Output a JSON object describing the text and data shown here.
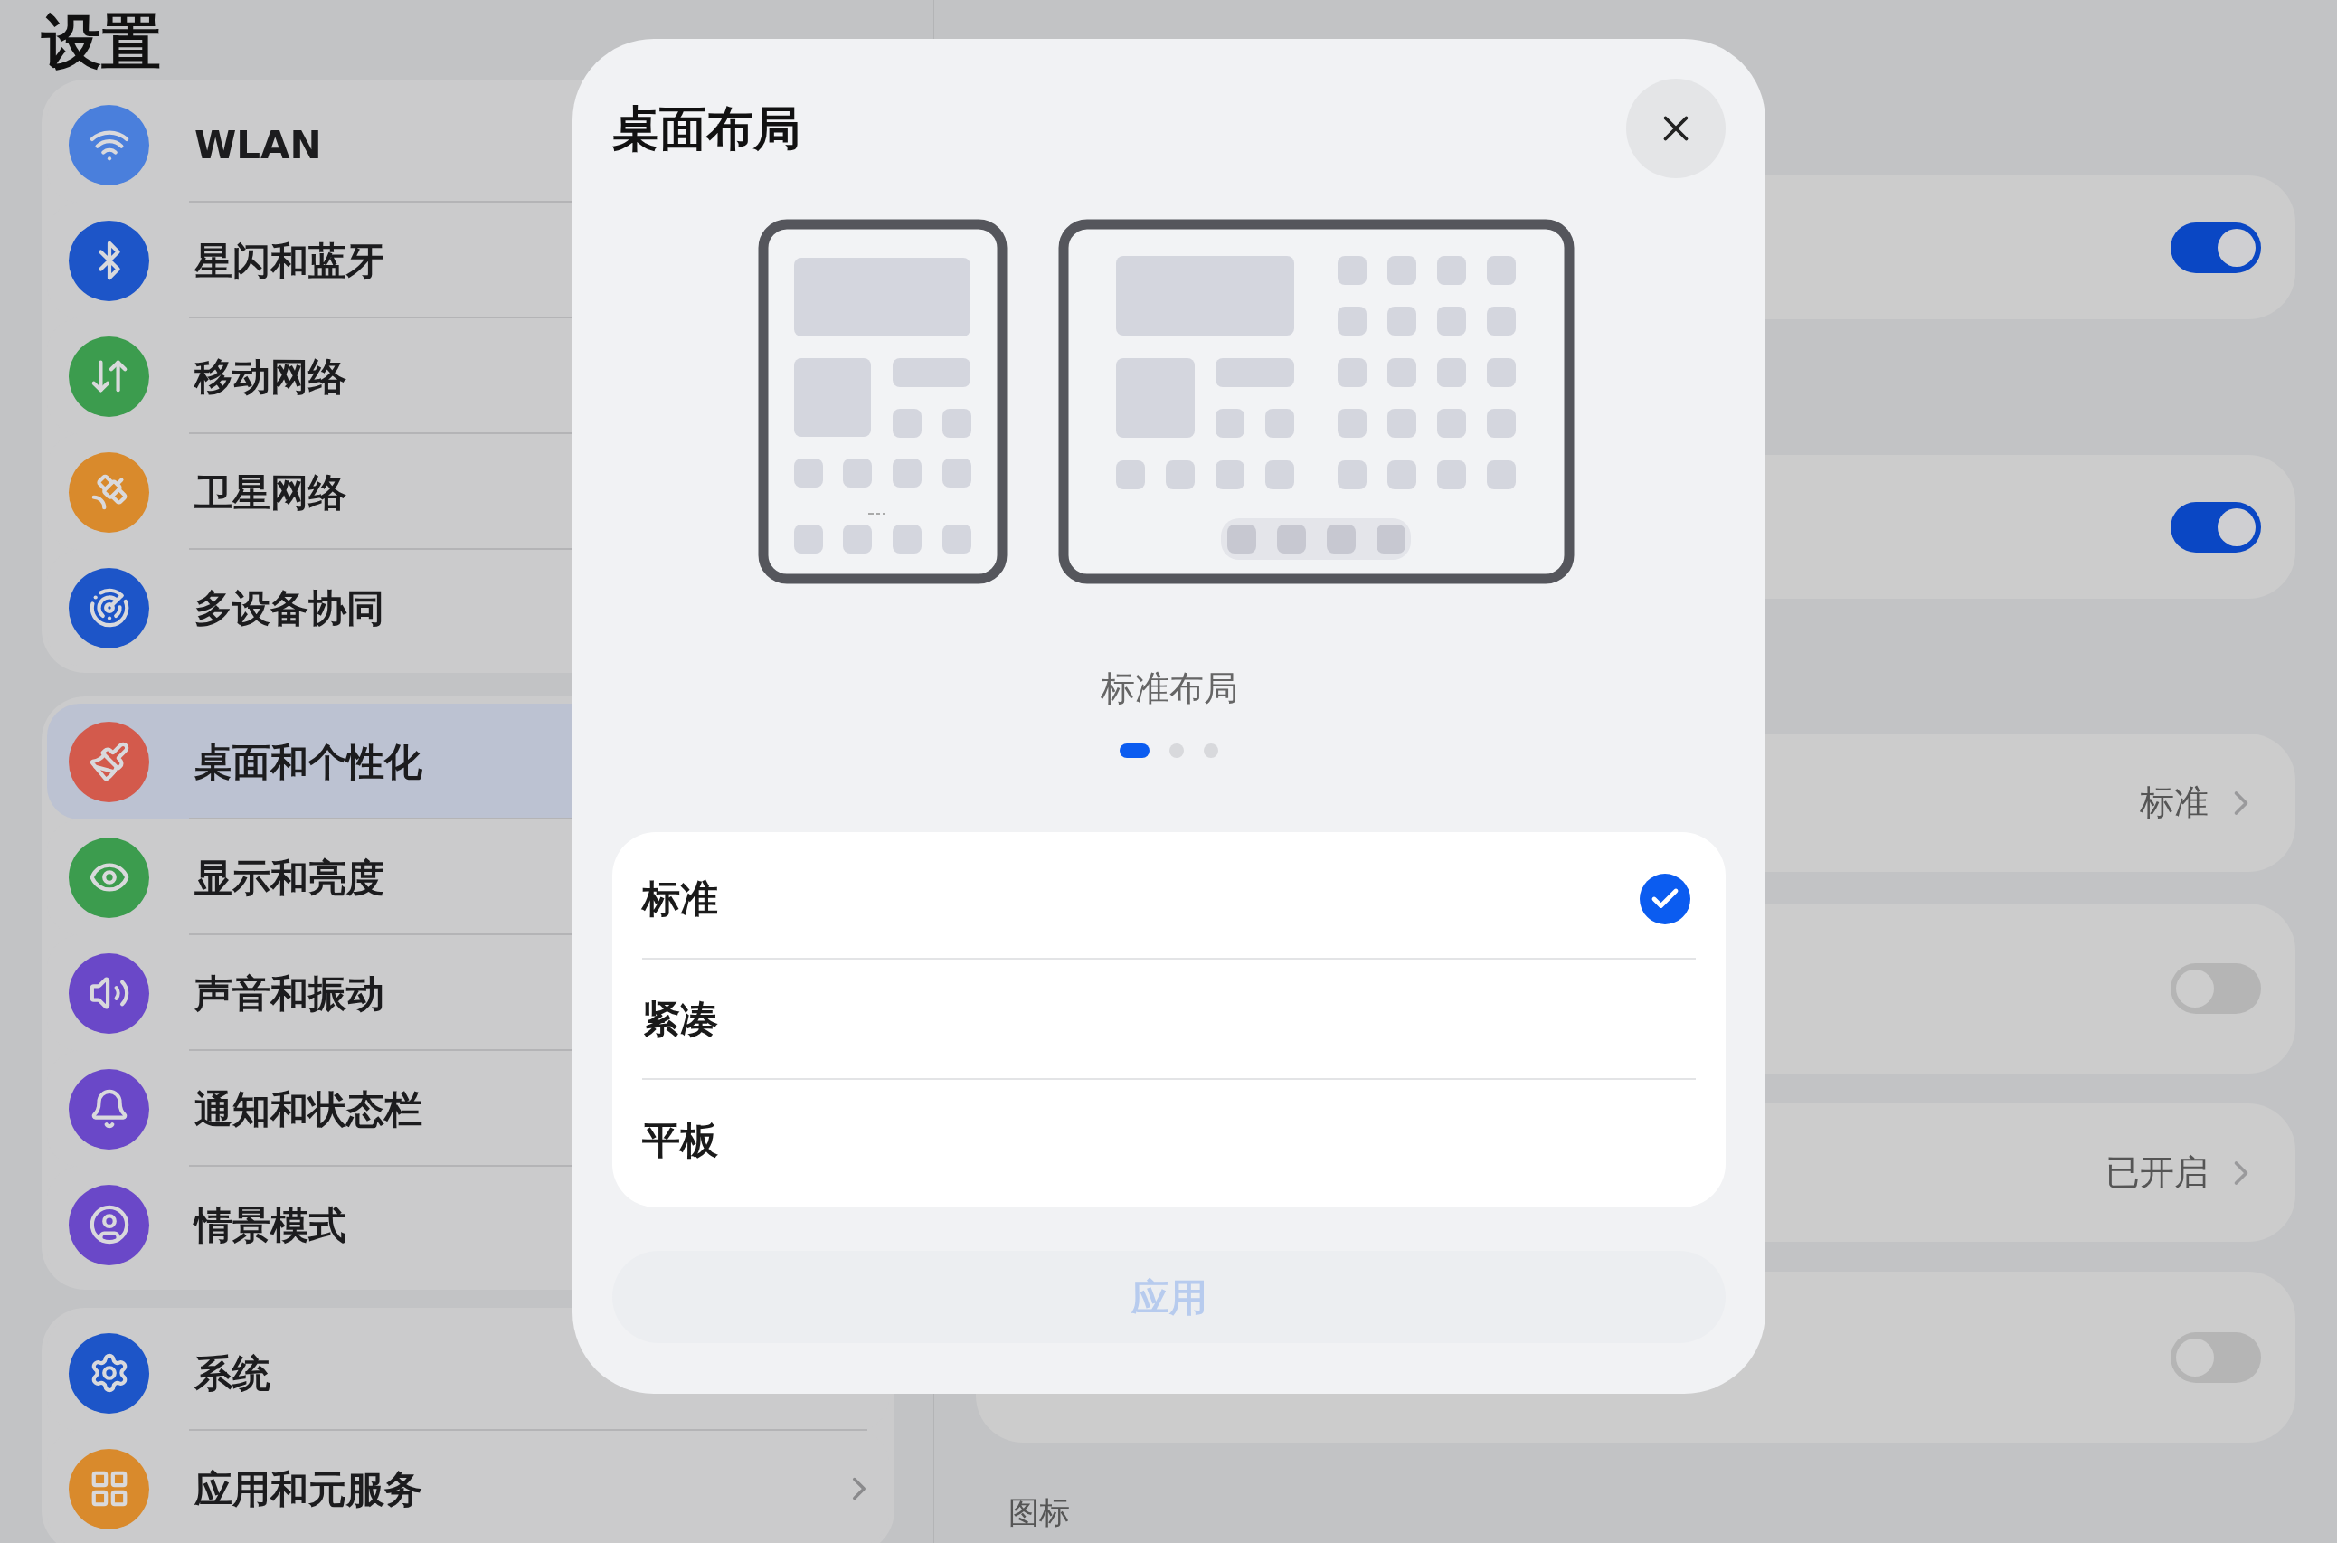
{
  "sidebar": {
    "title": "设置",
    "groups": [
      {
        "items": [
          {
            "label": "WLAN",
            "color": "#4a7fdc",
            "selected": false
          },
          {
            "label": "星闪和蓝牙",
            "color": "#1d55c8",
            "selected": false
          },
          {
            "label": "移动网络",
            "color": "#3c9c4e",
            "selected": false
          },
          {
            "label": "卫星网络",
            "color": "#d98a2c",
            "selected": false
          },
          {
            "label": "多设备协同",
            "color": "#1d55c8",
            "selected": false
          }
        ]
      },
      {
        "items": [
          {
            "label": "桌面和个性化",
            "color": "#d35a4c",
            "selected": true
          },
          {
            "label": "显示和亮度",
            "color": "#3c9c4e",
            "selected": false
          },
          {
            "label": "声音和振动",
            "color": "#6a48c8",
            "selected": false
          },
          {
            "label": "通知和状态栏",
            "color": "#6a48c8",
            "selected": false
          },
          {
            "label": "情景模式",
            "color": "#6a48c8",
            "selected": false
          }
        ]
      },
      {
        "items": [
          {
            "label": "系统",
            "color": "#1d55c8",
            "selected": false
          },
          {
            "label": "应用和元服务",
            "color": "#d98a2c",
            "selected": false
          }
        ]
      }
    ]
  },
  "settings": {
    "cards": [
      {
        "kind": "toggle",
        "on": true
      },
      {
        "kind": "toggle",
        "on": true
      },
      {
        "kind": "value",
        "value": "标准"
      },
      {
        "kind": "toggle",
        "on": false
      },
      {
        "kind": "value",
        "value": "已开启"
      },
      {
        "kind": "toggle",
        "on": false
      }
    ],
    "section_label": "图标"
  },
  "dialog": {
    "title": "桌面布局",
    "caption": "标准布局",
    "pages": [
      {
        "selected": true
      },
      {
        "selected": false
      },
      {
        "selected": false
      }
    ],
    "options": [
      {
        "label": "标准",
        "selected": true
      },
      {
        "label": "紧凑",
        "selected": false
      },
      {
        "label": "平板",
        "selected": false
      }
    ],
    "apply": {
      "label": "应用"
    }
  }
}
